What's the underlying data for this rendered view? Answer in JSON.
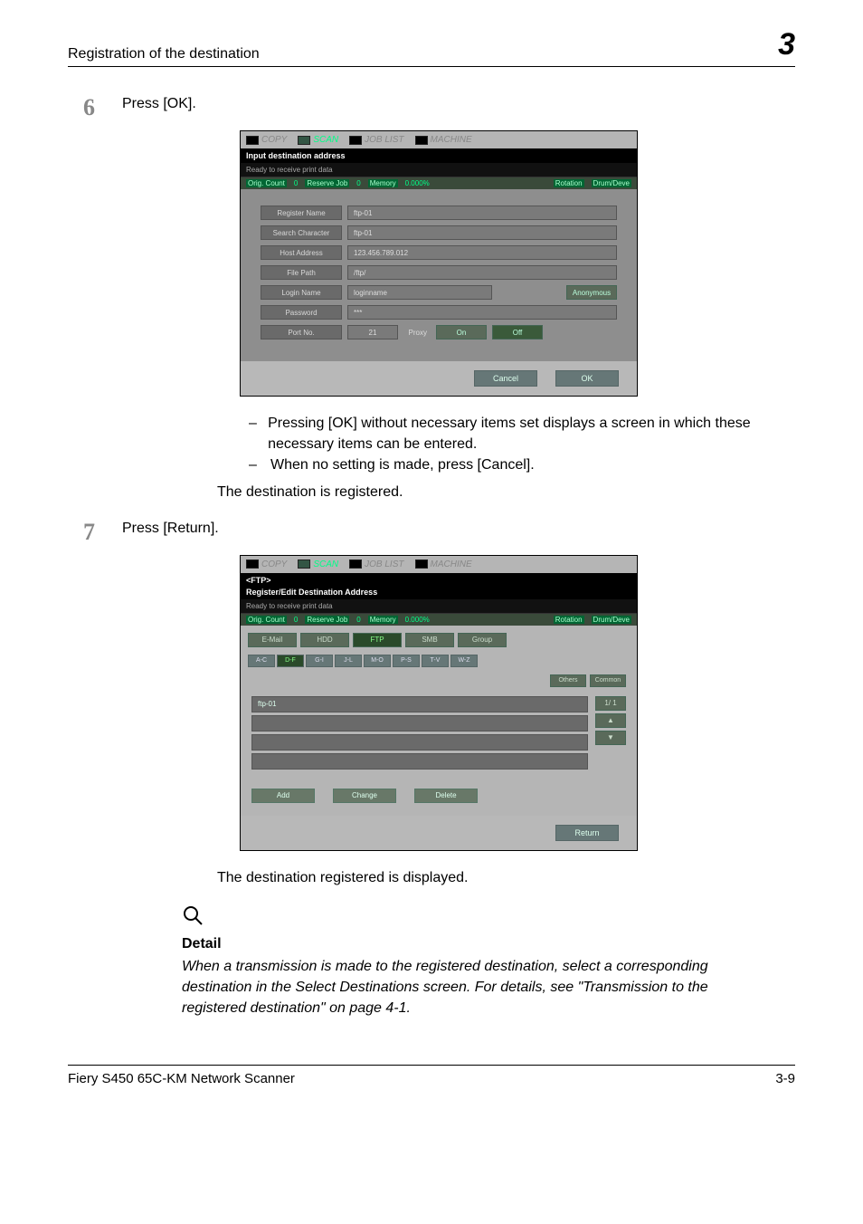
{
  "header": {
    "title": "Registration of the destination",
    "chapter": "3"
  },
  "step1": {
    "num": "6",
    "text": "Press [OK]."
  },
  "shot1": {
    "tabs": {
      "copy": "COPY",
      "scan": "SCAN",
      "joblist": "JOB LIST",
      "machine": "MACHINE"
    },
    "title": "Input destination address",
    "subtitle": "Ready to receive print data",
    "status": {
      "orig": "Orig. Count",
      "orig_v": "0",
      "reserve": "Reserve Job",
      "reserve_v": "0",
      "memory": "Memory",
      "memory_v": "0.000%",
      "rotation": "Rotation",
      "drum": "Drum/Deve"
    },
    "rows": {
      "regname_l": "Register Name",
      "regname_v": "ftp-01",
      "search_l": "Search Character",
      "search_v": "ftp-01",
      "host_l": "Host Address",
      "host_v": "123.456.789.012",
      "file_l": "File Path",
      "file_v": "/ftp/",
      "login_l": "Login Name",
      "login_v": "loginname",
      "anon": "Anonymous",
      "pass_l": "Password",
      "pass_v": "***",
      "port_l": "Port No.",
      "port_v": "21",
      "proxy": "Proxy",
      "on": "On",
      "off": "Off"
    },
    "cancel": "Cancel",
    "ok": "OK"
  },
  "bullets1": {
    "a": "Pressing [OK] without necessary items set displays a screen in which these necessary items can be entered.",
    "b": "When no setting is made, press [Cancel]."
  },
  "para1": "The destination is registered.",
  "step2": {
    "num": "7",
    "text": "Press [Return]."
  },
  "shot2": {
    "title1": "<FTP>",
    "title2": "Register/Edit Destination Address",
    "ttabs": {
      "email": "E-Mail",
      "hdd": "HDD",
      "ftp": "FTP",
      "smb": "SMB",
      "group": "Group"
    },
    "alpha": {
      "ac": "A-C",
      "df": "D-F",
      "gi": "G-I",
      "jl": "J-L",
      "mo": "M-O",
      "ps": "P-S",
      "tv": "T-V",
      "wz": "W-Z"
    },
    "others": "Others",
    "common": "Common",
    "item": "ftp-01",
    "page": "1/  1",
    "up": "▲",
    "down": "▼",
    "add": "Add",
    "change": "Change",
    "delete": "Delete",
    "return": "Return"
  },
  "para2": "The destination registered is displayed.",
  "detail": {
    "h": "Detail",
    "t": "When a transmission is made to the registered destination, select a corresponding destination in the Select Destinations screen. For details, see \"Transmission to the registered destination\" on page 4-1."
  },
  "footer": {
    "left": "Fiery S450 65C-KM Network Scanner",
    "right": "3-9"
  }
}
